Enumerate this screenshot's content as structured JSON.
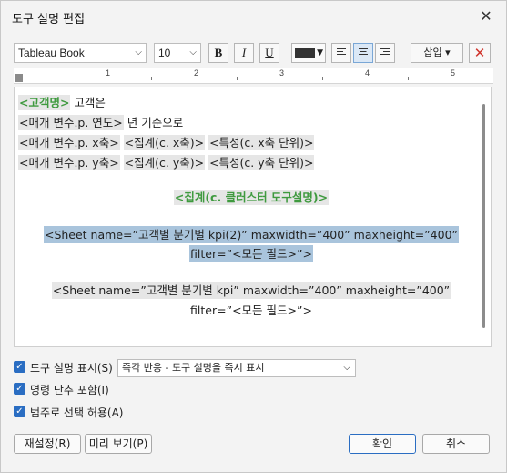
{
  "dialog": {
    "title": "도구 설명 편집",
    "close_icon": "close-icon"
  },
  "toolbar": {
    "font_family": "Tableau Book",
    "font_size": "10",
    "bold_label": "B",
    "italic_label": "I",
    "underline_label": "U",
    "text_color": "#333333",
    "insert_label": "삽입 ▾",
    "delete_icon": "delete-icon"
  },
  "ruler": {
    "numbers": [
      "1",
      "2",
      "3",
      "4",
      "5"
    ]
  },
  "editor": {
    "line1": {
      "tok1": "<고객명>",
      "text": " 고객은"
    },
    "line2": {
      "tok1": "<매개 변수.p. 연도>",
      "text": " 년 기준으로"
    },
    "line3": {
      "tok1": "<매개 변수.p. x축>",
      "tok2": "<집계(c. x축)>",
      "tok3": "<특성(c. x축 단위)>"
    },
    "line4": {
      "tok1": "<매개 변수.p. y축>",
      "tok2": "<집계(c. y축)>",
      "tok3": "<특성(c. y축 단위)>"
    },
    "cluster_line": "<집계(c. 클러스터 도구설명)>",
    "sheet1_line1": "<Sheet name=”고객별 분기별 kpi(2)” maxwidth=”400” maxheight=”400”",
    "sheet1_line2": "filter=”<모든 필드>”>",
    "sheet2_line1": "<Sheet name=”고객별 분기별 kpi” maxwidth=”400” maxheight=”400”",
    "sheet2_line2": "filter=”<모든 필드>”>"
  },
  "options": {
    "show_tooltip": "도구 설명 표시(S)",
    "tooltip_mode": "즉각 반응 - 도구 설명을 즉시 표시",
    "include_command_buttons": "명령 단추 포함(I)",
    "allow_range_selection": "범주로 선택 허용(A)"
  },
  "buttons": {
    "reset": "재설정(R)",
    "preview": "미리 보기(P)",
    "ok": "확인",
    "cancel": "취소"
  }
}
